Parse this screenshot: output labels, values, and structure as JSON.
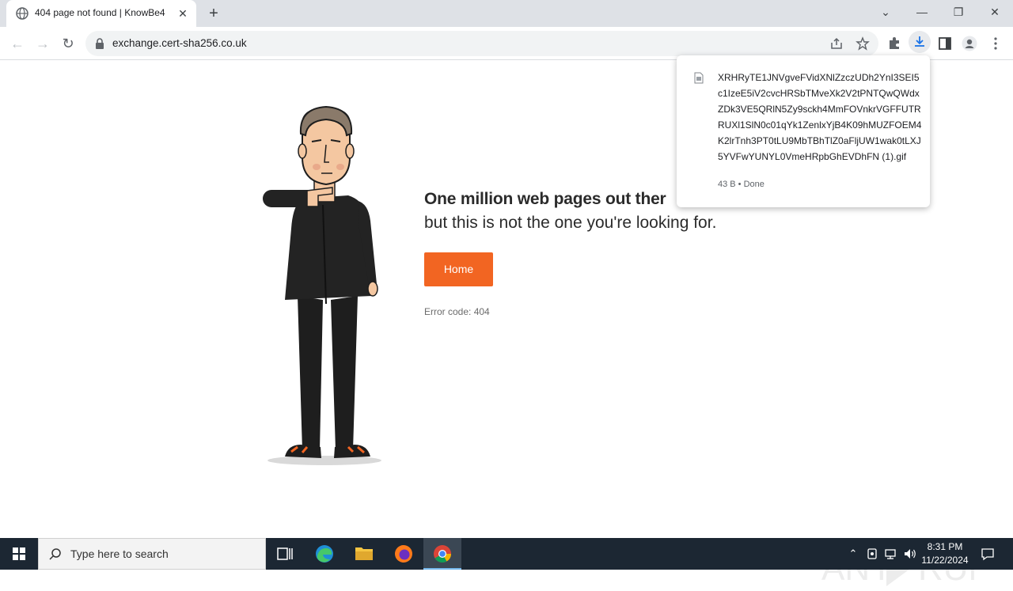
{
  "browser": {
    "tab": {
      "title": "404 page not found | KnowBe4",
      "close": "✕"
    },
    "new_tab": "+",
    "window_controls": {
      "dropdown": "⌄",
      "minimize": "—",
      "restore": "❐",
      "close": "✕"
    },
    "nav": {
      "back": "←",
      "forward": "→",
      "reload": "↻"
    },
    "url": "exchange.cert-sha256.co.uk"
  },
  "page": {
    "headline": "One million web pages out ther",
    "subline": "but this is not the one you're looking for.",
    "home_button": "Home",
    "error_code": "Error code: 404"
  },
  "download": {
    "filename": "XRHRyTE1JNVgveFVidXNlZzczUDh2YnI3SEI5c1IzeE5iV2cvcHRSbTMveXk2V2tPNTQwQWdxZDk3VE5QRlN5Zy9sckh4MmFOVnkrVGFFUTRRUXl1SlN0c01qYk1ZenlxYjB4K09hMUZFOEM4K2lrTnh3PT0tLU9MbTBhTlZ0aFljUW1wak0tLXJ5YVFwYUNYL0VmeHRpbGhEVDhFN (1).gif",
    "status": "43 B • Done"
  },
  "taskbar": {
    "search_placeholder": "Type here to search",
    "time": "8:31 PM",
    "date": "11/22/2024"
  },
  "colors": {
    "accent_orange": "#f26522",
    "taskbar": "#1c2733",
    "tab_strip": "#dee1e6"
  }
}
